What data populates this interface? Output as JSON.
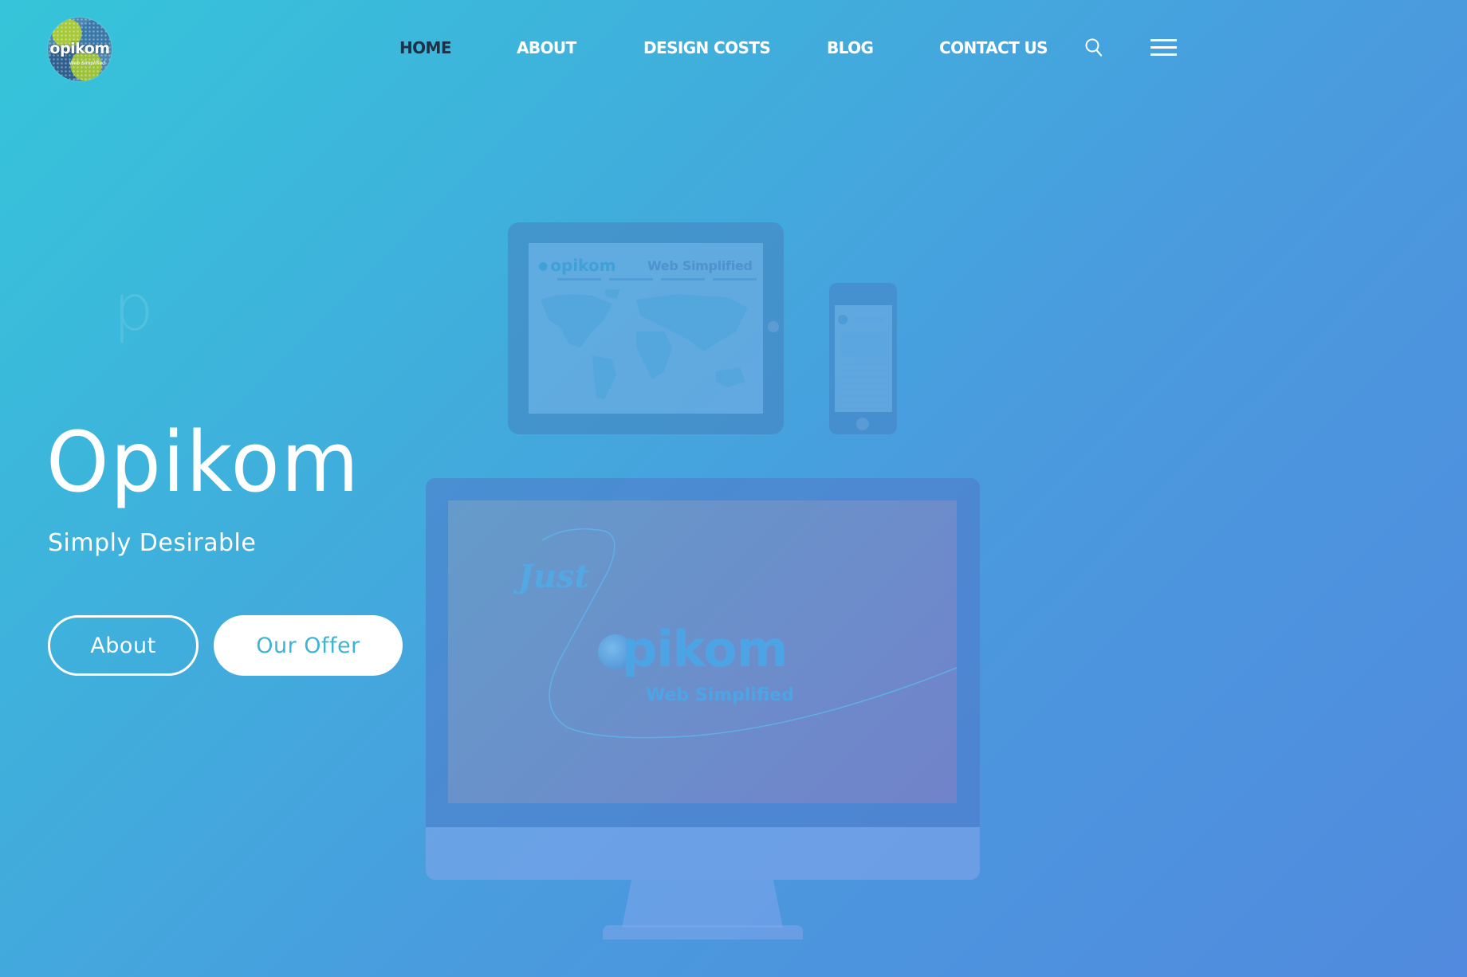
{
  "brand": {
    "logo_text": "opikom",
    "logo_sub": "Web Simplified"
  },
  "nav": {
    "items": [
      {
        "label": "HOME",
        "active": true
      },
      {
        "label": "ABOUT",
        "active": false
      },
      {
        "label": "DESIGN COSTS",
        "active": false
      },
      {
        "label": "BLOG",
        "active": false
      },
      {
        "label": "CONTACT US",
        "active": false
      }
    ],
    "search_icon": "search-icon",
    "menu_icon": "hamburger-menu-icon"
  },
  "hero": {
    "ghost_letter": "p",
    "title": "Opikom",
    "subtitle": "Simply Desirable",
    "buttons": {
      "about": "About",
      "offer": "Our Offer"
    }
  },
  "illustration": {
    "tablet_logo": "opikom",
    "tablet_tagline": "Web Simplified",
    "monitor_script": "Just",
    "monitor_logo": "pikom",
    "monitor_tagline": "Web Simplified"
  },
  "colors": {
    "gradient_start": "#35c5d9",
    "gradient_end": "#518ade",
    "nav_active": "#1b3249",
    "offer_text": "#3cb4d4"
  }
}
